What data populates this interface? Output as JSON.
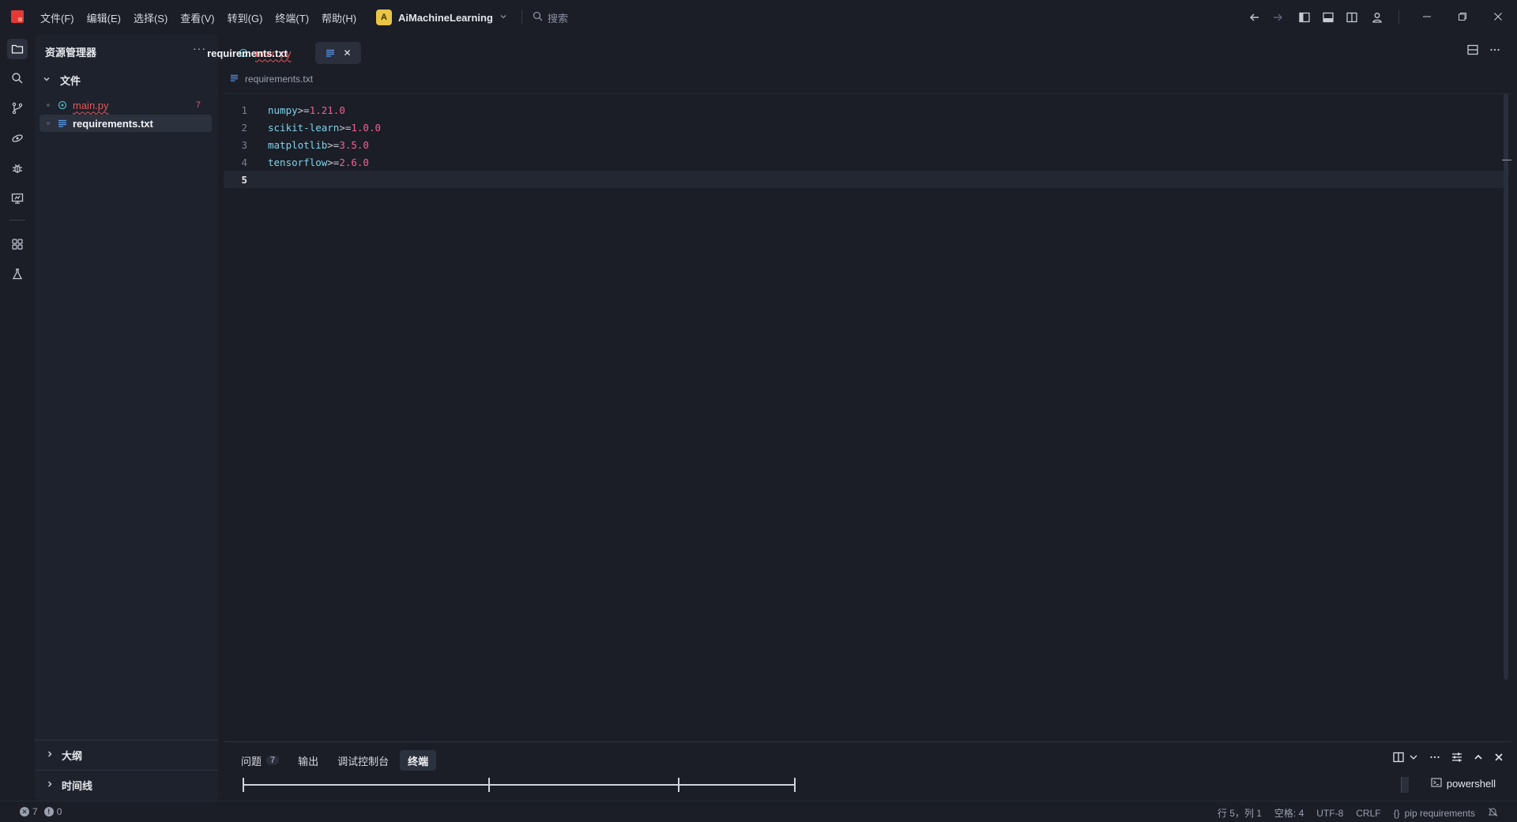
{
  "titlebar": {
    "menus": [
      "文件(F)",
      "编辑(E)",
      "选择(S)",
      "查看(V)",
      "转到(G)",
      "终端(T)",
      "帮助(H)"
    ],
    "project": {
      "badge": "A",
      "name": "AiMachineLearning"
    },
    "search_placeholder": "搜索"
  },
  "sidebar": {
    "title": "资源管理器",
    "more": "···",
    "folder": "文件",
    "files": [
      {
        "name": "main.py",
        "problems": "7"
      },
      {
        "name": "requirements.txt"
      }
    ],
    "sections": [
      "大纲",
      "时间线"
    ]
  },
  "editor": {
    "tabs": [
      {
        "label": "main.py"
      },
      {
        "label": "requirements.txt",
        "close": "✕"
      }
    ],
    "breadcrumb": "requirements.txt",
    "lines": [
      {
        "no": "1",
        "pkg": "numpy",
        "op": ">=",
        "ver": "1.21.0"
      },
      {
        "no": "2",
        "pkg": "scikit-learn",
        "op": ">=",
        "ver": "1.0.0"
      },
      {
        "no": "3",
        "pkg": "matplotlib",
        "op": ">=",
        "ver": "3.5.0"
      },
      {
        "no": "4",
        "pkg": "tensorflow",
        "op": ">=",
        "ver": "2.6.0"
      },
      {
        "no": "5",
        "pkg": "",
        "op": "",
        "ver": ""
      }
    ]
  },
  "panel": {
    "tabs": [
      {
        "label": "问题",
        "badge": "7"
      },
      {
        "label": "输出"
      },
      {
        "label": "调试控制台"
      },
      {
        "label": "终端"
      }
    ],
    "terminal_session": "powershell"
  },
  "statusbar": {
    "errors": "7",
    "warnings": "0",
    "position": "行 5，列 1",
    "indent": "空格: 4",
    "encoding": "UTF-8",
    "eol": "CRLF",
    "language": "pip requirements"
  },
  "colors": {
    "accent_error": "#e05a5a",
    "package": "#7fd2e8",
    "version": "#f06292",
    "project_badge": "#e8c547"
  }
}
